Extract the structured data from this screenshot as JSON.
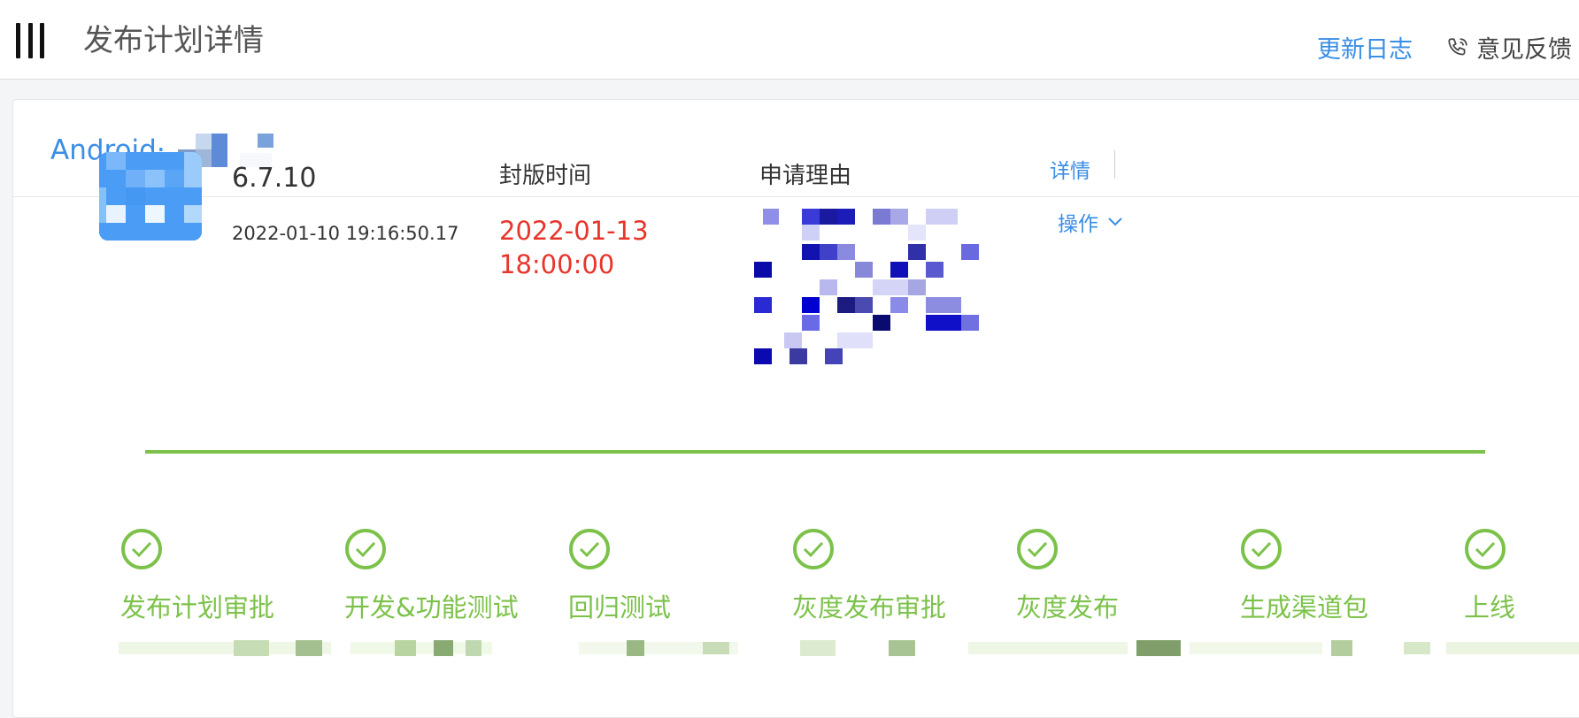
{
  "header": {
    "title": "发布计划详情",
    "changelog_label": "更新日志",
    "feedback_label": "意见反馈"
  },
  "app": {
    "name_prefix": "Android·"
  },
  "release": {
    "version": "6.7.10",
    "created_time": "2022-01-10 19:16:50.17",
    "freeze_label": "封版时间",
    "freeze_time": "2022-01-13 18:00:00",
    "reason_label": "申请理由",
    "detail_label": "详情",
    "ops_label": "操作"
  },
  "steps": [
    {
      "label": "发布计划审批",
      "status": "done"
    },
    {
      "label": "开发&功能测试",
      "status": "done"
    },
    {
      "label": "回归测试",
      "status": "done"
    },
    {
      "label": "灰度发布审批",
      "status": "done"
    },
    {
      "label": "灰度发布",
      "status": "done"
    },
    {
      "label": "生成渠道包",
      "status": "done"
    },
    {
      "label": "上线",
      "status": "done"
    }
  ],
  "colors": {
    "accent": "#3a8ee6",
    "success": "#7cc24a",
    "danger": "#e8352b"
  },
  "icons": {
    "menu": "menu-icon",
    "feedback": "phone-icon",
    "check": "check-icon",
    "chevron": "chevron-down-icon"
  }
}
